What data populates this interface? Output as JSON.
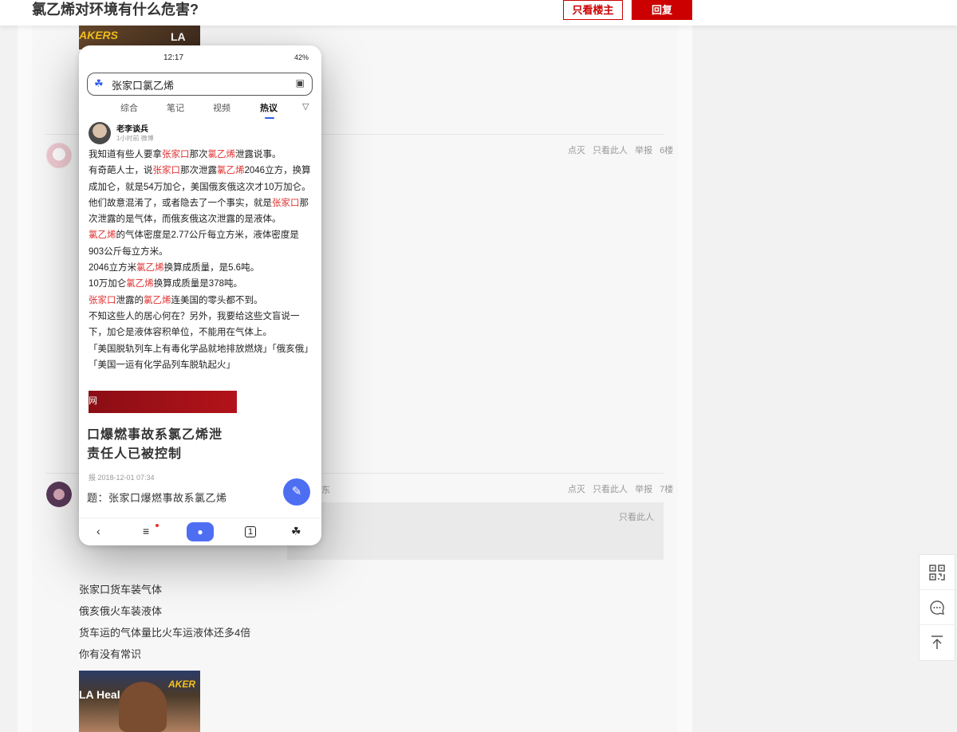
{
  "header": {
    "title": "氯乙烯对环境有什么危害?",
    "only_landlord": "只看楼主",
    "reply": "回复"
  },
  "posts": [
    {
      "actions": [
        "点灭",
        "只看此人",
        "举报"
      ],
      "floor": "6楼"
    },
    {
      "actions": [
        "点灭",
        "只看此人",
        "举报"
      ],
      "floor": "7楼",
      "name_fragment": "东",
      "quote_only": "只看此人",
      "reply_lines": [
        "张家口货车装气体",
        "俄亥俄火车装液体",
        "货车运的气体量比火车运液体还多4倍",
        "你有没有常识"
      ]
    }
  ],
  "image_text": {
    "lakers": "AKERS",
    "la_health_top": "LA He",
    "la_health_bottom": "LA Heal",
    "lakers_bottom": "AKER"
  },
  "phone": {
    "time": "12:17",
    "battery": "42%",
    "search_query": "张家口氯乙烯",
    "tabs": [
      "综合",
      "笔记",
      "视频",
      "热议"
    ],
    "author": "老李谈兵",
    "author_meta": "1小时前  微博",
    "article": [
      [
        {
          "t": "我知道有些人要拿"
        },
        {
          "t": "张家口",
          "hl": true
        },
        {
          "t": "那次"
        },
        {
          "t": "氯乙烯",
          "hl": true
        },
        {
          "t": "泄露说事。"
        }
      ],
      [
        {
          "t": "有奇葩人士，说"
        },
        {
          "t": "张家口",
          "hl": true
        },
        {
          "t": "那次泄露"
        },
        {
          "t": "氯乙烯",
          "hl": true
        },
        {
          "t": "2046立方，换算成加仑，就是54万加仑，美国俄亥俄这次才10万加仑。"
        }
      ],
      [
        {
          "t": "他们故意混淆了，或者隐去了一个事实，就是"
        },
        {
          "t": "张家口",
          "hl": true
        },
        {
          "t": "那次泄露的是气体，而俄亥俄这次泄露的是液体。"
        }
      ],
      [
        {
          "t": "氯乙烯",
          "hl": true
        },
        {
          "t": "的气体密度是2.77公斤每立方米，液体密度是903公斤每立方米。"
        }
      ],
      [
        {
          "t": "2046立方米"
        },
        {
          "t": "氯乙烯",
          "hl": true
        },
        {
          "t": "换算成质量，是5.6吨。"
        }
      ],
      [
        {
          "t": "10万加仑"
        },
        {
          "t": "氯乙烯",
          "hl": true
        },
        {
          "t": "换算成质量是378吨。"
        }
      ],
      [
        {
          "t": "张家口",
          "hl": true
        },
        {
          "t": "泄露的"
        },
        {
          "t": "氯乙烯",
          "hl": true
        },
        {
          "t": "连美国的零头都不到。"
        }
      ],
      [
        {
          "t": "不知这些人的居心何在？另外，我要给这些文盲说一下，加仑是液体容积单位，不能用在气体上。"
        }
      ],
      [
        {
          "t": "「美国脱轨列车上有毒化学品就地排放燃烧」「俄亥俄」「美国一运有化学品列车脱轨起火」"
        }
      ]
    ],
    "banner_char": "网",
    "news_title_line1": "口爆燃事故系氯乙烯泄",
    "news_title_line2": "责任人已被控制",
    "news_meta": "报    2018-12-01 07:34",
    "news_sub": "题：张家口爆燃事故系氯乙烯"
  },
  "colors": {
    "accent": "#cc0000",
    "highlight": "#e03131",
    "baidu_blue": "#4e6ef2"
  }
}
